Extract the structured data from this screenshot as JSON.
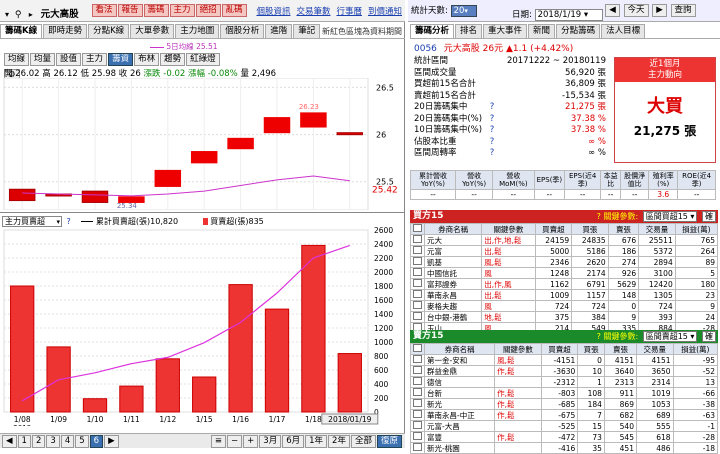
{
  "left": {
    "stock_input": "元大高股",
    "stock_buttons": [
      "看法",
      "報告",
      "籌碼",
      "主力",
      "絕招",
      "亂碼"
    ],
    "header_links": [
      "個股資訊",
      "交易筆數",
      "行事曆",
      "到價通知"
    ],
    "tabs": [
      "籌碼K線",
      "即時走勢",
      "分點K線",
      "大單參數",
      "主力地圖",
      "個股分析",
      "進階",
      "筆記"
    ],
    "broker_note": "新紅色區塊為資料期間",
    "ma_label": "5日均線",
    "mode_buttons": [
      "均線",
      "均量",
      "設值",
      "主力",
      "籌資",
      "布林",
      "趨勢",
      "紅綠燈"
    ],
    "ohlc": {
      "open_label": "開",
      "open": "26.02",
      "high_label": "高",
      "high": "26.12",
      "low_label": "低",
      "low": "25.98",
      "close_label": "收",
      "close": "26",
      "chg_label": "漲跌",
      "chg": "-0.02",
      "pct_label": "漲幅",
      "pct": "-0.08%",
      "vol_label": "量",
      "vol": "2,496"
    },
    "upper_axis": [
      "26.5",
      "26",
      "25.5"
    ],
    "upper_price_tag": "25.42",
    "marker_top": "26.23",
    "marker_bottom": "25.34",
    "lower_select": "主力買賣超",
    "lower_legend": [
      {
        "label": "累計買賣超(張)",
        "value": "10,820"
      },
      {
        "label": "買賣超(張)",
        "value": "835"
      }
    ],
    "lower_axis": [
      "2600",
      "2400",
      "2200",
      "2000",
      "1800",
      "1600",
      "1400",
      "1200",
      "1000",
      "800",
      "600",
      "400",
      "200",
      "0"
    ],
    "x_axis": [
      "1/08",
      "1/09",
      "1/10",
      "1/11",
      "1/12",
      "1/15",
      "1/16",
      "1/17",
      "1/18",
      "2018/01/19"
    ],
    "year_label": "2018",
    "pager": [
      "1",
      "2",
      "3",
      "4",
      "5",
      "6"
    ],
    "range_buttons": [
      "3月",
      "6月",
      "1年",
      "2年",
      "全部",
      "復原"
    ]
  },
  "right": {
    "stat_day_label": "統計天數",
    "stat_day_value": "20",
    "date_label": "日期",
    "date_value": "2018/1/19",
    "today_label": "今天",
    "query_label": "查詢",
    "tabs": [
      "籌碼分析",
      "排名",
      "重大事件",
      "新聞",
      "分點籌碼",
      "法人目標"
    ],
    "stock_code": "0056",
    "stock_name": "元大高股",
    "stock_price": "26元",
    "stock_chg": "▲1.1 (+4.42%)",
    "stats": [
      {
        "label": "統計區間",
        "value": "20171222 ~ 20180119",
        "color": "black"
      },
      {
        "label": "區間成交量",
        "value": "56,920 張",
        "color": "black"
      },
      {
        "label": "買超前15名合計",
        "value": "36,809 張",
        "color": "black"
      },
      {
        "label": "賣超前15名合計",
        "value": "-15,534 張",
        "color": "black"
      },
      {
        "label": "20日籌碼集中",
        "value": "21,275 張",
        "color": "red"
      },
      {
        "label": "20日籌碼集中(%)",
        "value": "37.38 %",
        "color": "red"
      },
      {
        "label": "10日籌碼集中(%)",
        "value": "37.38 %",
        "color": "red"
      },
      {
        "label": "佔股本比重",
        "value": "∞ %",
        "color": "red"
      },
      {
        "label": "區間周轉率",
        "value": "∞ %",
        "color": "black"
      }
    ],
    "signal_head": "近1個月",
    "signal_sub": "主力動向",
    "signal_main": "大買",
    "signal_value": "21,275 張",
    "rev_headers": [
      "累計營收YoY(%)",
      "營收YoY(%)",
      "營收MoM(%)",
      "EPS(季)",
      "EPS(近4季)",
      "本益比",
      "股價淨值比",
      "殖利率(%)",
      "ROE(近4季)"
    ],
    "rev_values": [
      "--",
      "--",
      "--",
      "--",
      "--",
      "--",
      "--",
      "3.6",
      "--"
    ],
    "buy": {
      "title": "買方15",
      "filter_label": "關鍵參數",
      "filter_value": "區間買超15",
      "cols": [
        "券商名稱",
        "關鍵參數",
        "買賣超",
        "買張",
        "賣張",
        "交易量",
        "損益(萬)"
      ],
      "rows": [
        [
          "元大",
          "出,作,地,鬆",
          "24159",
          "24835",
          "676",
          "25511",
          "765"
        ],
        [
          "元富",
          "出,鬆",
          "5000",
          "5186",
          "186",
          "5372",
          "264"
        ],
        [
          "凱基",
          "風,鬆",
          "2346",
          "2620",
          "274",
          "2894",
          "89"
        ],
        [
          "中國信託",
          "風",
          "1248",
          "2174",
          "926",
          "3100",
          "5"
        ],
        [
          "富邦證券",
          "出,作,風",
          "1162",
          "6791",
          "5629",
          "12420",
          "180"
        ],
        [
          "華南永昌",
          "出,鬆",
          "1009",
          "1157",
          "148",
          "1305",
          "23"
        ],
        [
          "麥格夫趨",
          "風",
          "724",
          "724",
          "0",
          "724",
          "9"
        ],
        [
          "台中銀-港鶴",
          "地,鬆",
          "375",
          "384",
          "9",
          "393",
          "24"
        ],
        [
          "玉山",
          "風",
          "214",
          "549",
          "335",
          "884",
          "-28"
        ]
      ]
    },
    "sell": {
      "title": "賣方15",
      "filter_label": "關鍵參數",
      "filter_value": "區間賣超15",
      "cols": [
        "券商名稱",
        "關鍵參數",
        "買賣超",
        "買張",
        "賣張",
        "交易量",
        "損益(萬)"
      ],
      "rows": [
        [
          "第一金-安和",
          "風,鬆",
          "-4151",
          "0",
          "4151",
          "4151",
          "-95"
        ],
        [
          "群益金鼎",
          "作,鬆",
          "-3630",
          "10",
          "3640",
          "3650",
          "-52"
        ],
        [
          "德信",
          "",
          "-2312",
          "1",
          "2313",
          "2314",
          "13"
        ],
        [
          "台新",
          "作,鬆",
          "-803",
          "108",
          "911",
          "1019",
          "-66"
        ],
        [
          "新光",
          "作,鬆",
          "-685",
          "184",
          "869",
          "1053",
          "-38"
        ],
        [
          "華南永昌-中正",
          "作,鬆",
          "-675",
          "7",
          "682",
          "689",
          "-63"
        ],
        [
          "元富-大昌",
          "",
          "-525",
          "15",
          "540",
          "555",
          "-1"
        ],
        [
          "富豐",
          "作,鬆",
          "-472",
          "73",
          "545",
          "618",
          "-28"
        ],
        [
          "新光-桃園",
          "",
          "-416",
          "35",
          "451",
          "486",
          "-18"
        ]
      ]
    },
    "action_buttons": [
      "確",
      "更"
    ]
  },
  "chart_data": [
    {
      "type": "candlestick",
      "categories": [
        "1/08",
        "1/09",
        "1/10",
        "1/11",
        "1/12",
        "1/15",
        "1/16",
        "1/17",
        "1/18",
        "2018/01/19"
      ],
      "series": [
        {
          "name": "K",
          "open": [
            25.42,
            25.37,
            25.4,
            25.28,
            25.45,
            25.7,
            25.85,
            26.02,
            26.08,
            26.02
          ],
          "close": [
            25.3,
            25.35,
            25.28,
            25.34,
            25.62,
            25.82,
            25.96,
            26.18,
            26.23,
            26.0
          ]
        }
      ],
      "ma_series": {
        "name": "5日均線",
        "values": [
          25.38,
          25.37,
          25.36,
          25.35,
          25.37,
          25.4,
          25.46,
          25.52,
          25.56,
          25.51
        ]
      },
      "ylim": [
        25.2,
        26.6
      ]
    },
    {
      "type": "bar",
      "categories": [
        "1/08",
        "1/09",
        "1/10",
        "1/11",
        "1/12",
        "1/15",
        "1/16",
        "1/17",
        "1/18",
        "2018/01/19"
      ],
      "series": [
        {
          "name": "買賣超(張)",
          "values": [
            1800,
            930,
            190,
            370,
            760,
            500,
            1820,
            1470,
            2380,
            835
          ]
        },
        {
          "name": "累計買賣超(張)",
          "values": [
            160,
            460,
            560,
            690,
            780,
            990,
            1280,
            1700,
            2200,
            2380
          ]
        }
      ],
      "ylim": [
        0,
        2600
      ]
    }
  ]
}
